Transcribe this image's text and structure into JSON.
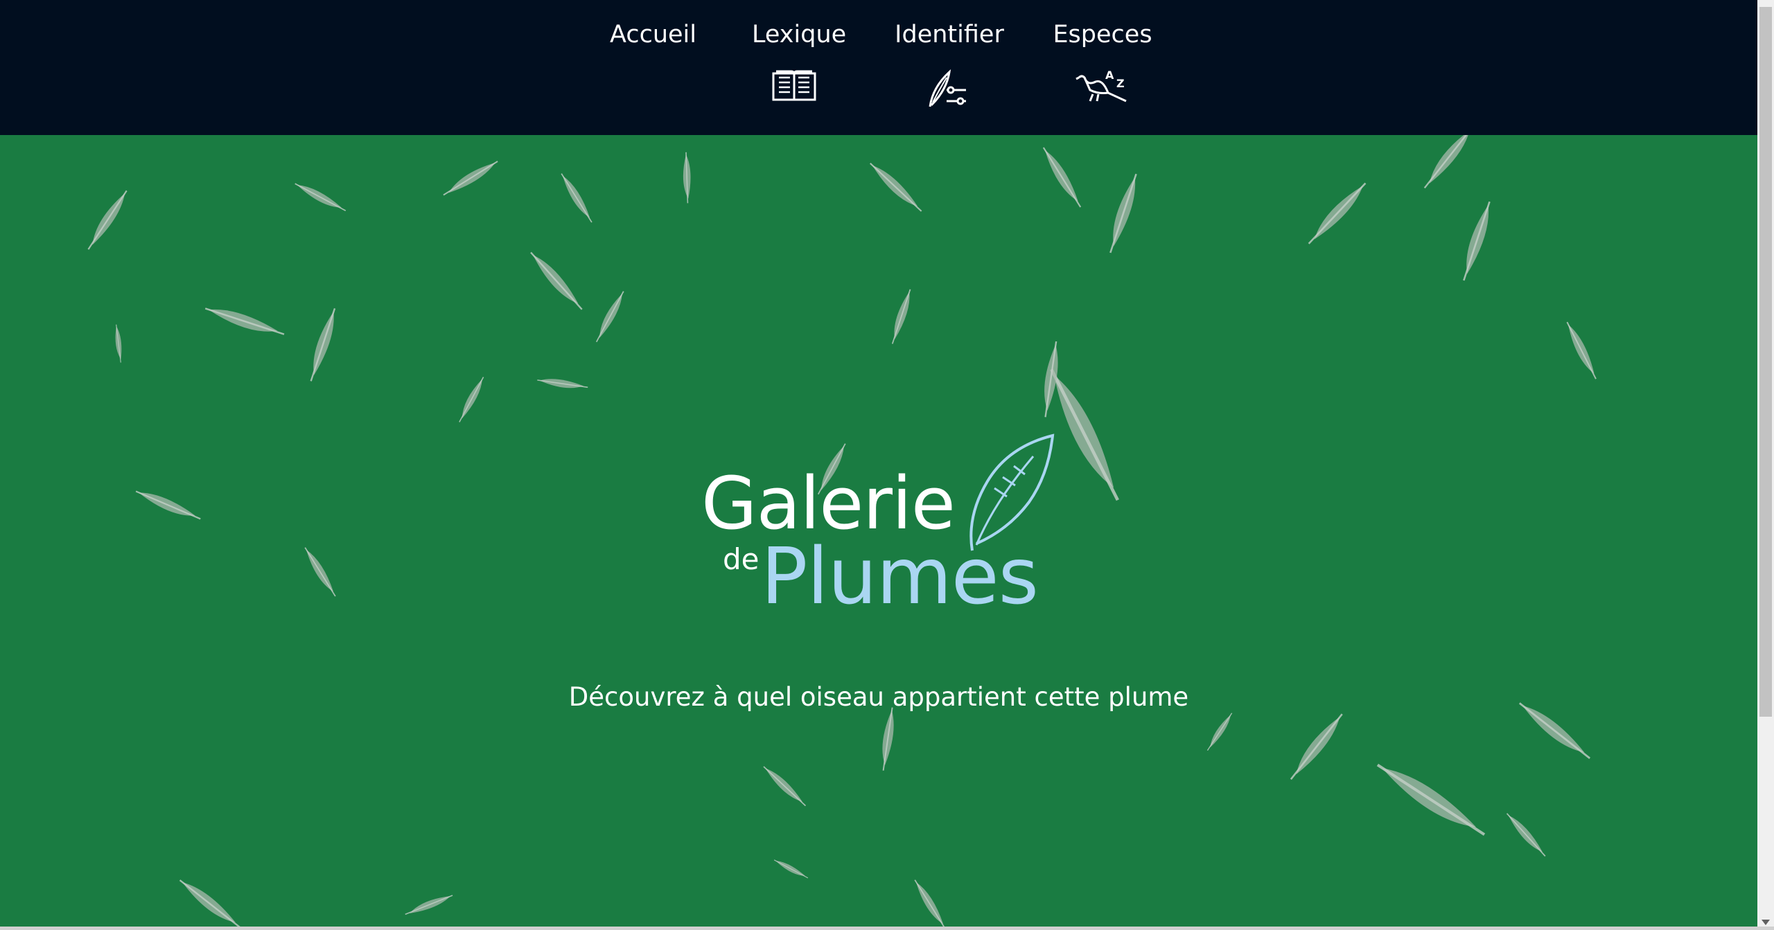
{
  "nav": {
    "items": [
      {
        "label": "Accueil",
        "icon": ""
      },
      {
        "label": "Lexique",
        "icon": "book-icon"
      },
      {
        "label": "Identifier",
        "icon": "feather-filter-icon"
      },
      {
        "label": "Especes",
        "icon": "bird-az-icon"
      }
    ]
  },
  "hero": {
    "logo": {
      "line1": "Galerie",
      "de": "de",
      "line2": "Plumes"
    },
    "tagline": "Découvrez à quel oiseau appartient cette plume",
    "background_color": "#1a7c42",
    "accent_color": "#aad6f2"
  },
  "colors": {
    "topbar": "#010e1f"
  }
}
